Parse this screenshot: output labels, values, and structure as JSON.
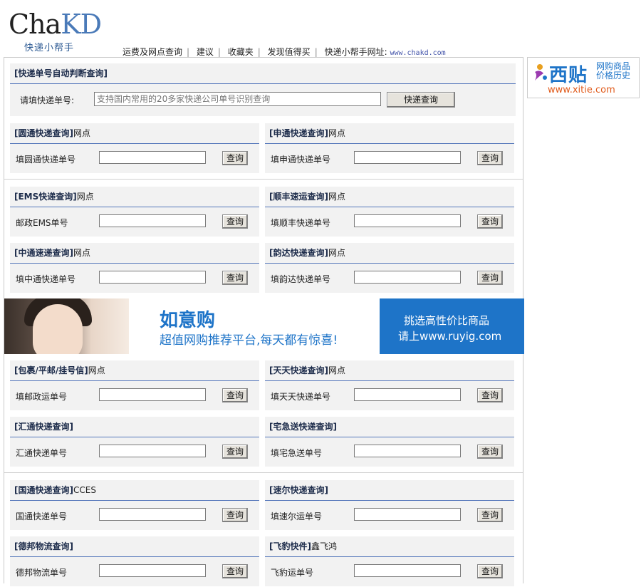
{
  "logo": {
    "cha": "Cha",
    "kd": "KD",
    "sub": "快递小帮手"
  },
  "nav": {
    "items": [
      "运费及网点查询",
      "建议",
      "收藏夹",
      "发现值得买"
    ],
    "site_label": "快递小帮手网址:",
    "site_url": "www.chakd.com"
  },
  "auto": {
    "title": "快递单号自动判断查询",
    "label": "请填快递单号:",
    "placeholder": "支持国内常用的20多家快递公司单号识别查询",
    "button": "快递查询"
  },
  "query_button": "查询",
  "cards": [
    {
      "title": "圆通快递查询",
      "suffix": "网点",
      "label": "填圆通快递单号"
    },
    {
      "title": "申通快递查询",
      "suffix": "网点",
      "label": "填申通快递单号"
    },
    {
      "title": "EMS快递查询",
      "suffix": "网点",
      "label": "邮政EMS单号"
    },
    {
      "title": "顺丰速运查询",
      "suffix": "网点",
      "label": "填顺丰快递单号"
    },
    {
      "title": "中通速递查询",
      "suffix": "网点",
      "label": "填中通快递单号"
    },
    {
      "title": "韵达快递查询",
      "suffix": "网点",
      "label": "填韵达快递单号"
    },
    {
      "title": "包裹/平邮/挂号信",
      "suffix": "网点",
      "label": "填邮政运单号"
    },
    {
      "title": "天天快递查询",
      "suffix": "网点",
      "label": "填天天快递单号"
    },
    {
      "title": "汇通快递查询",
      "suffix": "",
      "label": "汇通快递单号"
    },
    {
      "title": "宅急送快递查询",
      "suffix": "",
      "label": "填宅急送单号"
    },
    {
      "title": "国通快递查询",
      "suffix": "CCES",
      "label": "国通快递单号"
    },
    {
      "title": "速尔快递查询",
      "suffix": "",
      "label": "填速尔运单号"
    },
    {
      "title": "德邦物流查询",
      "suffix": "",
      "label": "德邦物流单号"
    },
    {
      "title": "飞豹快件",
      "suffix": "鑫飞鸿",
      "label": "飞豹运单号"
    }
  ],
  "banner": {
    "brand": "如意购",
    "slogan": "超值网购推荐平台,每天都有惊喜!",
    "right1": "挑选高性价比商品",
    "right2": "请上www.ruyig.com"
  },
  "side_ad": {
    "brand": "西贴",
    "tagline": "网购商品价格历史",
    "url": "www.xitie.com"
  },
  "colors": {
    "accent_blue": "#1e74c8",
    "header_rule": "#5577bb",
    "card_bg": "#f2f2f2"
  }
}
